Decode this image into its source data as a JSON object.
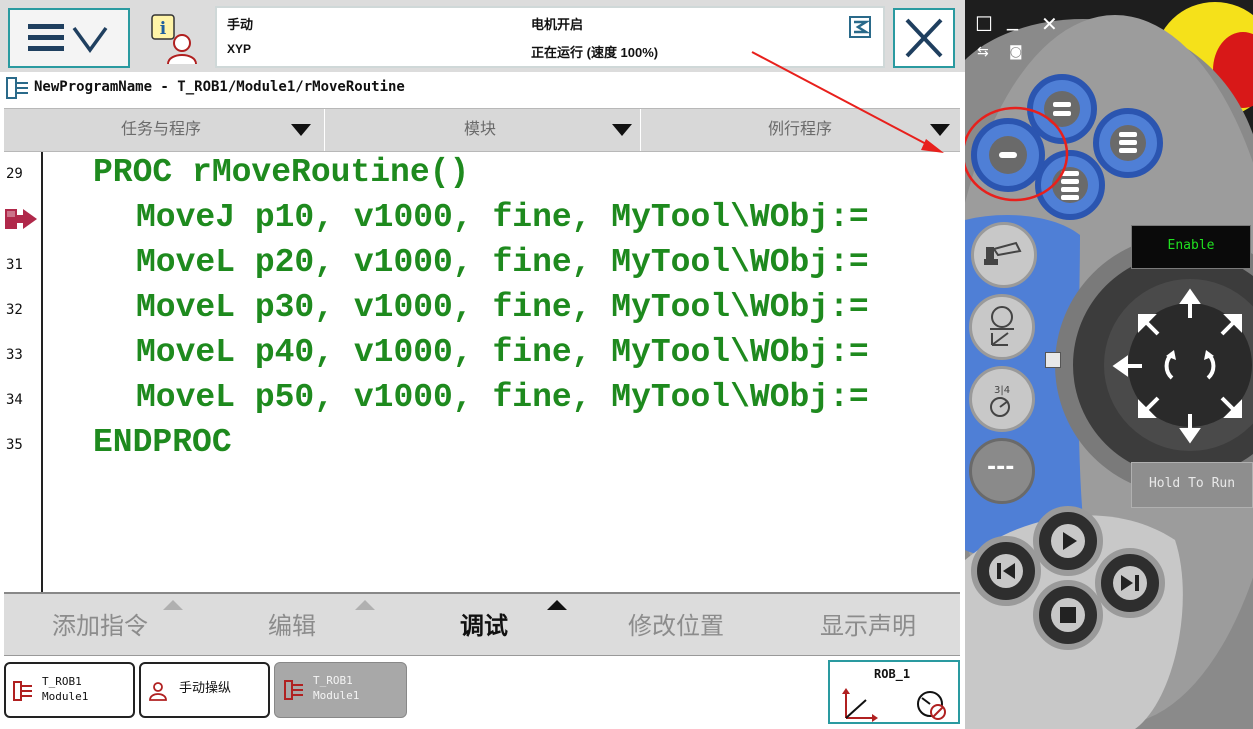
{
  "header": {
    "mode": "手动",
    "system_name": "XYP",
    "motor_status": "电机开启",
    "run_status": "正在运行 (速度 100%)"
  },
  "path": "NewProgramName - T_ROB1/Module1/rMoveRoutine",
  "selectors": [
    "任务与程序",
    "模块",
    "例行程序"
  ],
  "code": {
    "line_numbers": [
      "29",
      "31",
      "32",
      "33",
      "34",
      "35"
    ],
    "lines": [
      "PROC rMoveRoutine()",
      "MoveJ p10, v1000, fine, MyTool\\WObj:=",
      "MoveL p20, v1000, fine, MyTool\\WObj:=",
      "MoveL p30, v1000, fine, MyTool\\WObj:=",
      "MoveL p40, v1000, fine, MyTool\\WObj:=",
      "MoveL p50, v1000, fine, MyTool\\WObj:=",
      "ENDPROC"
    ]
  },
  "commands": [
    "添加指令",
    "编辑",
    "调试",
    "修改位置",
    "显示声明"
  ],
  "taskbar": {
    "item1_line1": "T_ROB1",
    "item1_line2": "Module1",
    "item2": "手动操纵",
    "item3_line1": "T_ROB1",
    "item3_line2": "Module1",
    "robot": "ROB_1"
  },
  "panel": {
    "enable_label": "Enable",
    "hold_label": "Hold To Run"
  },
  "colors": {
    "accent": "#2a9aa0",
    "code": "#1e8a1e",
    "panel_blue": "#4f7fd6",
    "panel_yellow": "#f5e11a",
    "annotation": "#e8201c"
  }
}
